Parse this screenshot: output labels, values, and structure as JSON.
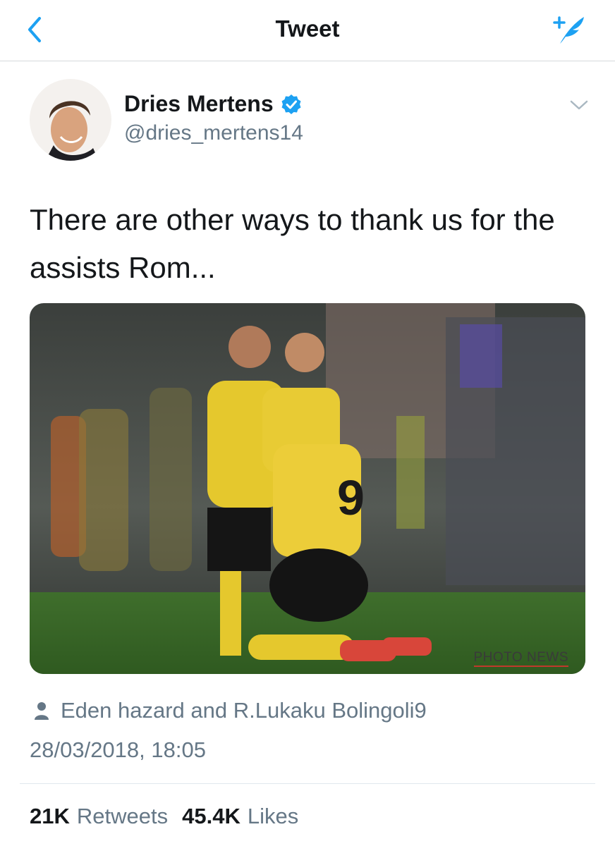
{
  "nav": {
    "title": "Tweet",
    "back_icon": "chevron-left-icon",
    "compose_icon": "compose-tweet-icon",
    "accent": "#1da1f2"
  },
  "author": {
    "name": "Dries Mertens",
    "handle": "@dries_mertens14",
    "verified": true,
    "verified_color": "#1da1f2"
  },
  "tweet": {
    "text": "There are other ways to thank us for the assists Rom...",
    "media_watermark": "PHOTO NEWS",
    "tagged": "Eden hazard and R.Lukaku Bolingoli9",
    "timestamp": "28/03/2018, 18:05"
  },
  "stats": {
    "retweets_count": "21K",
    "retweets_label": "Retweets",
    "likes_count": "45.4K",
    "likes_label": "Likes"
  },
  "colors": {
    "text": "#14171a",
    "secondary": "#657786",
    "border": "#e1e8ed"
  }
}
